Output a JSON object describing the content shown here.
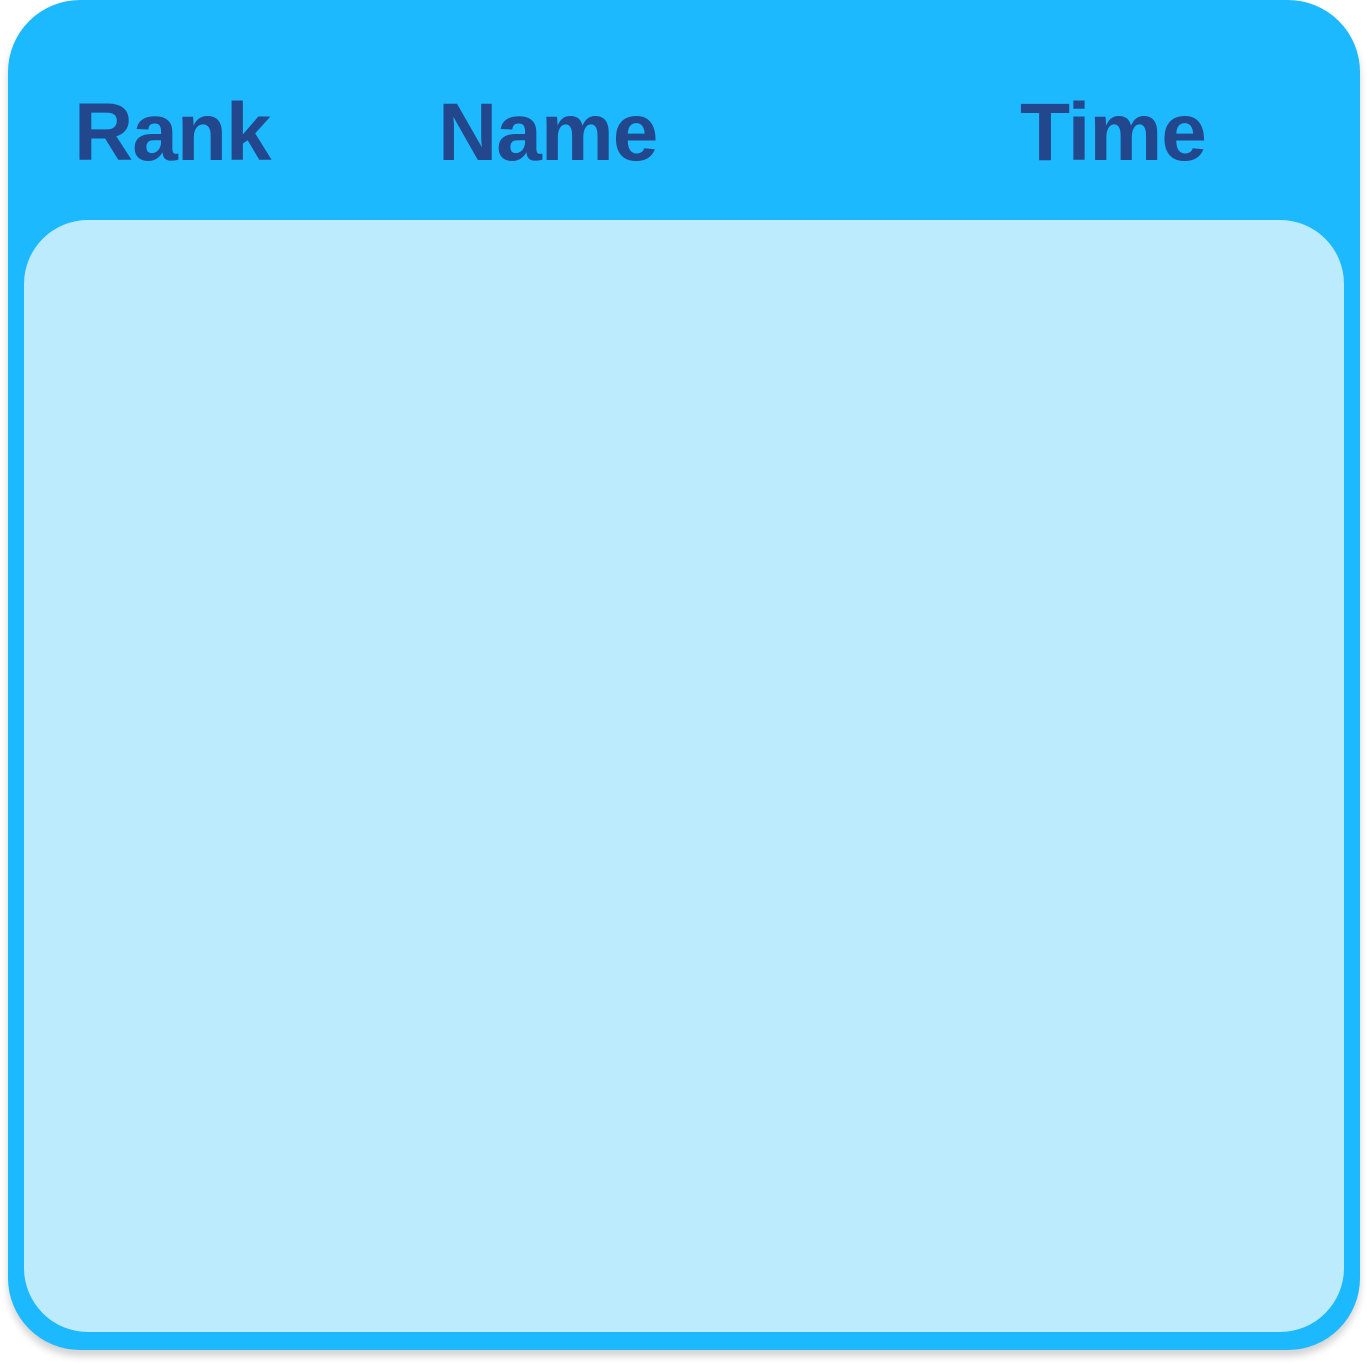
{
  "leaderboard": {
    "columns": {
      "rank": "Rank",
      "name": "Name",
      "time": "Time"
    },
    "rows": []
  },
  "colors": {
    "frame": "#1cb9ff",
    "panel": "#bdebfe",
    "header_text": "#23478c"
  }
}
